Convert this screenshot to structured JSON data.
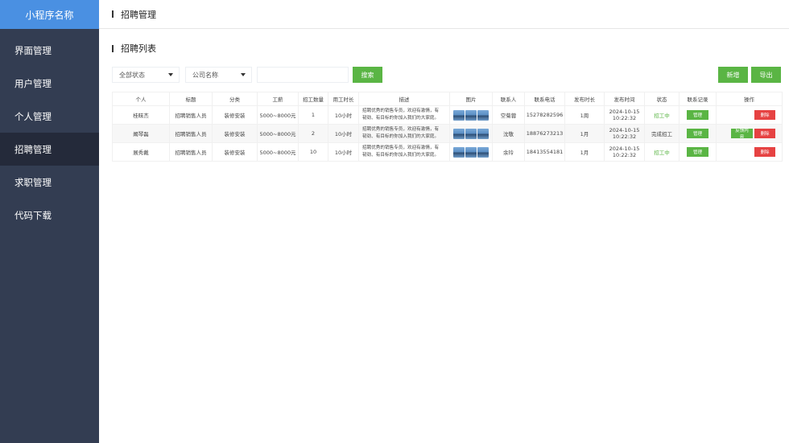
{
  "app": {
    "brand": "小程序名称"
  },
  "sidebar": {
    "items": [
      {
        "label": "界面管理",
        "active": false
      },
      {
        "label": "用户管理",
        "active": false
      },
      {
        "label": "个人管理",
        "active": false
      },
      {
        "label": "招聘管理",
        "active": true
      },
      {
        "label": "求职管理",
        "active": false
      },
      {
        "label": "代码下载",
        "active": false
      }
    ]
  },
  "header": {
    "title": "招聘管理"
  },
  "section": {
    "title": "招聘列表"
  },
  "filters": {
    "status_select": "全部状态",
    "company_select": "公司名称",
    "keyword_value": "",
    "search_label": "搜索",
    "add_label": "新增",
    "export_label": "导出"
  },
  "table": {
    "columns": [
      "个人",
      "标题",
      "分类",
      "工薪",
      "招工数量",
      "用工时长",
      "描述",
      "图片",
      "联系人",
      "联系电话",
      "发布时长",
      "发布时间",
      "状态",
      "联系记录",
      "操作"
    ],
    "rows": [
      {
        "person": "桂昧杰",
        "title": "招聘销售人员",
        "category": "装修安装",
        "salary": "5000~8000元",
        "count": "1",
        "duration": "10小时",
        "desc1": "招聘优秀的销售专员，欢迎有激情，有",
        "desc2": "韧劲、有目标的你加入我们的大家庭。",
        "contact": "空菊蓉",
        "phone": "15278282596",
        "period": "1周",
        "date": "2024-10-15",
        "time": "10:22:32",
        "status": "招工中",
        "manage_label": "管理",
        "feedback_label": "",
        "delete_label": "删除"
      },
      {
        "person": "阚琴磊",
        "title": "招聘销售人员",
        "category": "装修安装",
        "salary": "5000~8000元",
        "count": "2",
        "duration": "10小时",
        "desc1": "招聘优秀的销售专员，欢迎有激情，有",
        "desc2": "韧劲、有目标的你加入我们的大家庭。",
        "contact": "沈敬",
        "phone": "18876273213",
        "period": "1月",
        "date": "2024-10-15",
        "time": "10:22:32",
        "status": "完成招工",
        "manage_label": "管理",
        "feedback_label": "反馈内容",
        "delete_label": "删除"
      },
      {
        "person": "展秀戴",
        "title": "招聘销售人员",
        "category": "装修安装",
        "salary": "5000~8000元",
        "count": "10",
        "duration": "10小时",
        "desc1": "招聘优秀的销售专员，欢迎有激情，有",
        "desc2": "韧劲、有目标的你加入我们的大家庭。",
        "contact": "余玲",
        "phone": "18413554181",
        "period": "1月",
        "date": "2024-10-15",
        "time": "10:22:32",
        "status": "招工中",
        "manage_label": "管理",
        "feedback_label": "",
        "delete_label": "删除"
      }
    ]
  },
  "colors": {
    "sidebar_bg": "#333d52",
    "brand_bg": "#4a90e2",
    "active_nav": "#242a3a",
    "primary_green": "#5ab544",
    "danger_red": "#e64242"
  }
}
